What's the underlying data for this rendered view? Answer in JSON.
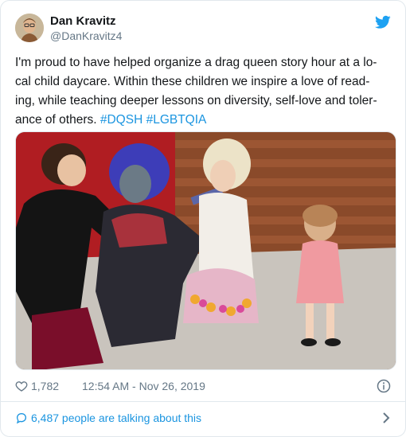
{
  "author": {
    "name": "Dan Kravitz",
    "handle": "@DanKravitz4",
    "avatar_icon": "user-avatar"
  },
  "tweet": {
    "lines": [
      "I'm proud to have helped organize a drag queen story hour at a lo-",
      "cal child daycare. Within these children we inspire a love of read-",
      "ing, while teaching deeper lessons on diversity, self-love and toler-"
    ],
    "last_line_text": "ance of others.",
    "hashtags": [
      "#DQSH",
      "#LGBTQIA"
    ]
  },
  "meta": {
    "likes": "1,782",
    "timestamp": "12:54 AM - Nov 26, 2019"
  },
  "footer": {
    "talking": "6,487 people are talking about this"
  },
  "colors": {
    "twitter_blue": "#1b95e0",
    "muted_gray": "#657786",
    "text": "#14171a",
    "border": "#e1e8ed"
  }
}
